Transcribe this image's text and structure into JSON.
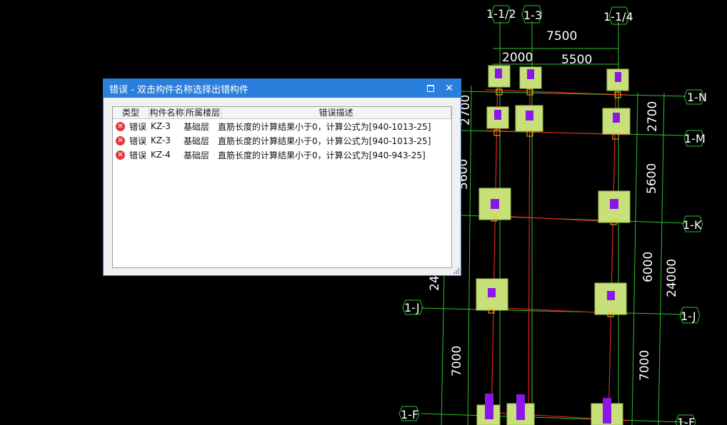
{
  "cad": {
    "axis_top": [
      "1-1/2",
      "1-3",
      "1-1/4"
    ],
    "axis_right": [
      "1-N",
      "1-M",
      "1-K",
      "1-J",
      "1-F"
    ],
    "axis_left": [
      "1-J",
      "1-F"
    ],
    "dims_top": [
      "7500",
      "2000",
      "5500"
    ],
    "dims_right": [
      "2700",
      "5600",
      "6000",
      "7000",
      "24000"
    ],
    "dims_left": [
      "2700",
      "5600",
      "24",
      "7000"
    ],
    "colors": {
      "grid_line": "#2fbf2f",
      "beam": "#e02020",
      "footing": "#c8e07a",
      "column": "#8a17e8"
    }
  },
  "dialog": {
    "title": "错误 - 双击构件名称选择出错构件",
    "icons": [
      "maximize-icon",
      "close-icon"
    ],
    "columns": [
      "类型",
      "构件名称",
      "所属楼层",
      "错误描述"
    ],
    "rows": [
      {
        "type": "错误",
        "name": "KZ-3",
        "floor": "基础层",
        "desc": "直筋长度的计算结果小于0，计算公式为[940-1013-25]"
      },
      {
        "type": "错误",
        "name": "KZ-3",
        "floor": "基础层",
        "desc": "直筋长度的计算结果小于0，计算公式为[940-1013-25]"
      },
      {
        "type": "错误",
        "name": "KZ-4",
        "floor": "基础层",
        "desc": "直筋长度的计算结果小于0，计算公式为[940-943-25]"
      }
    ]
  }
}
